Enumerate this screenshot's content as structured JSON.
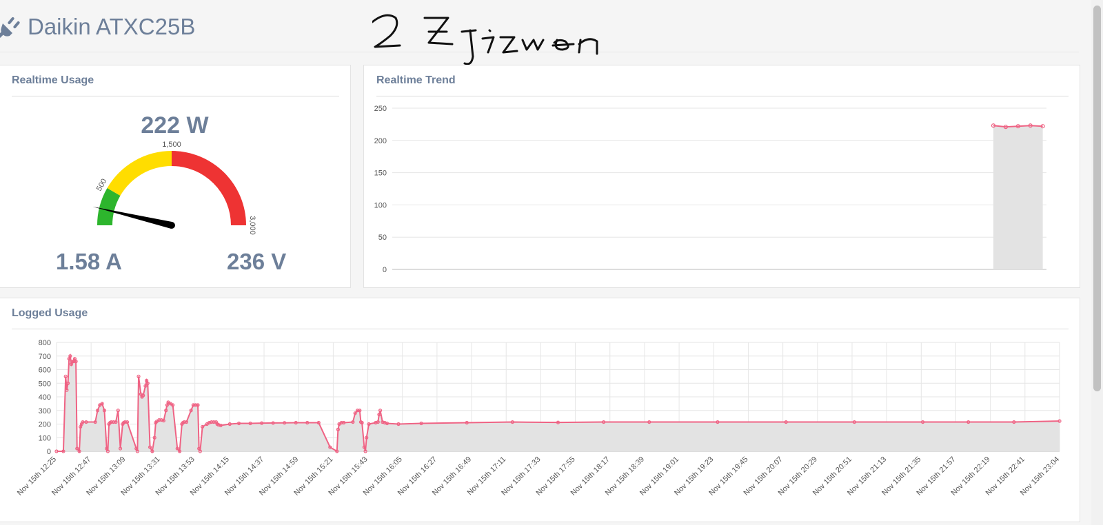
{
  "header": {
    "title": "Daikin ATXC25B",
    "icon": "plug-icon"
  },
  "handwriting": "2 Z Jizuen",
  "realtime_usage": {
    "title": "Realtime Usage",
    "power": "222 W",
    "current": "1.58 A",
    "voltage": "236 V",
    "gauge": {
      "min": 0,
      "max": 3000,
      "value": 222,
      "bands": [
        {
          "from": 0,
          "to": 500,
          "color": "#2db52d"
        },
        {
          "from": 500,
          "to": 1500,
          "color": "#ffdd00"
        },
        {
          "from": 1500,
          "to": 3000,
          "color": "#ee3333"
        }
      ],
      "labels": [
        "500",
        "1,500",
        "3,000"
      ]
    }
  },
  "realtime_trend": {
    "title": "Realtime Trend",
    "chart_data": {
      "type": "area",
      "ylim": [
        0,
        250
      ],
      "yticks": [
        "0",
        "50",
        "100",
        "150",
        "200",
        "250"
      ],
      "x": [
        0,
        1,
        2,
        3,
        4
      ],
      "values": [
        223,
        221,
        222,
        223,
        222
      ],
      "line_color": "#ef6384",
      "fill_color": "#e3e3e3"
    }
  },
  "logged_usage": {
    "title": "Logged Usage",
    "chart_data": {
      "type": "area",
      "ylim": [
        0,
        800
      ],
      "yticks": [
        "0",
        "100",
        "200",
        "300",
        "400",
        "500",
        "600",
        "700",
        "800"
      ],
      "categories": [
        "Nov 15th 12:25",
        "Nov 15th 12:47",
        "Nov 15th 13:09",
        "Nov 15th 13:31",
        "Nov 15th 13:53",
        "Nov 15th 14:15",
        "Nov 15th 14:37",
        "Nov 15th 14:59",
        "Nov 15th 15:21",
        "Nov 15th 15:43",
        "Nov 15th 16:05",
        "Nov 15th 16:27",
        "Nov 15th 16:49",
        "Nov 15th 17:11",
        "Nov 15th 17:33",
        "Nov 15th 17:55",
        "Nov 15th 18:17",
        "Nov 15th 18:39",
        "Nov 15th 19:01",
        "Nov 15th 19:23",
        "Nov 15th 19:45",
        "Nov 15th 20:07",
        "Nov 15th 20:29",
        "Nov 15th 20:51",
        "Nov 15th 21:13",
        "Nov 15th 21:35",
        "Nov 15th 21:57",
        "Nov 15th 22:19",
        "Nov 15th 22:41",
        "Nov 15th 23:04"
      ],
      "x": [
        0,
        3,
        4,
        4.5,
        5,
        5.5,
        6,
        6.5,
        7,
        7.5,
        8,
        8.5,
        9,
        10,
        10.5,
        11,
        11.5,
        13,
        17,
        18,
        19,
        20,
        21,
        22,
        22.5,
        23,
        23.5,
        24,
        25,
        26,
        27,
        28,
        29,
        29.5,
        30,
        31,
        35,
        35.5,
        36,
        37,
        37.5,
        38,
        39,
        39.5,
        40,
        41,
        42,
        43,
        43.5,
        44,
        45,
        46,
        47,
        48,
        48.5,
        49,
        50,
        51,
        53,
        54,
        55,
        55.5,
        56,
        57,
        59,
        60,
        61,
        62,
        62.5,
        63,
        64,
        66,
        67,
        68,
        69,
        70,
        70.5,
        71,
        72,
        76,
        80,
        85,
        90,
        95,
        100,
        105,
        110,
        115,
        120,
        123,
        123.5,
        124,
        125,
        126,
        130,
        131,
        132,
        133,
        133.5,
        134,
        135,
        135.5,
        136,
        137,
        140,
        141,
        141.5,
        142,
        143,
        144,
        145,
        150,
        160,
        180,
        200,
        220,
        240,
        260,
        290,
        320,
        350,
        380,
        400,
        420,
        440
      ],
      "values": [
        0,
        0,
        550,
        450,
        500,
        680,
        700,
        640,
        660,
        660,
        680,
        660,
        20,
        0,
        180,
        200,
        215,
        215,
        215,
        300,
        340,
        350,
        300,
        20,
        0,
        200,
        210,
        215,
        215,
        215,
        300,
        20,
        200,
        210,
        215,
        215,
        20,
        0,
        550,
        420,
        400,
        410,
        480,
        520,
        500,
        30,
        0,
        100,
        210,
        220,
        230,
        230,
        225,
        300,
        340,
        360,
        350,
        340,
        20,
        0,
        200,
        210,
        215,
        215,
        300,
        340,
        340,
        340,
        20,
        0,
        180,
        200,
        210,
        215,
        215,
        215,
        200,
        195,
        190,
        200,
        205,
        205,
        207,
        208,
        209,
        210,
        210,
        210,
        30,
        0,
        160,
        200,
        210,
        210,
        215,
        280,
        300,
        300,
        215,
        210,
        30,
        0,
        100,
        200,
        210,
        215,
        270,
        300,
        215,
        210,
        205,
        200,
        205,
        210,
        215,
        212,
        215,
        215,
        215,
        215,
        215,
        215,
        215,
        215,
        222
      ],
      "line_color": "#ef6384",
      "fill_color": "#e3e3e3"
    }
  }
}
